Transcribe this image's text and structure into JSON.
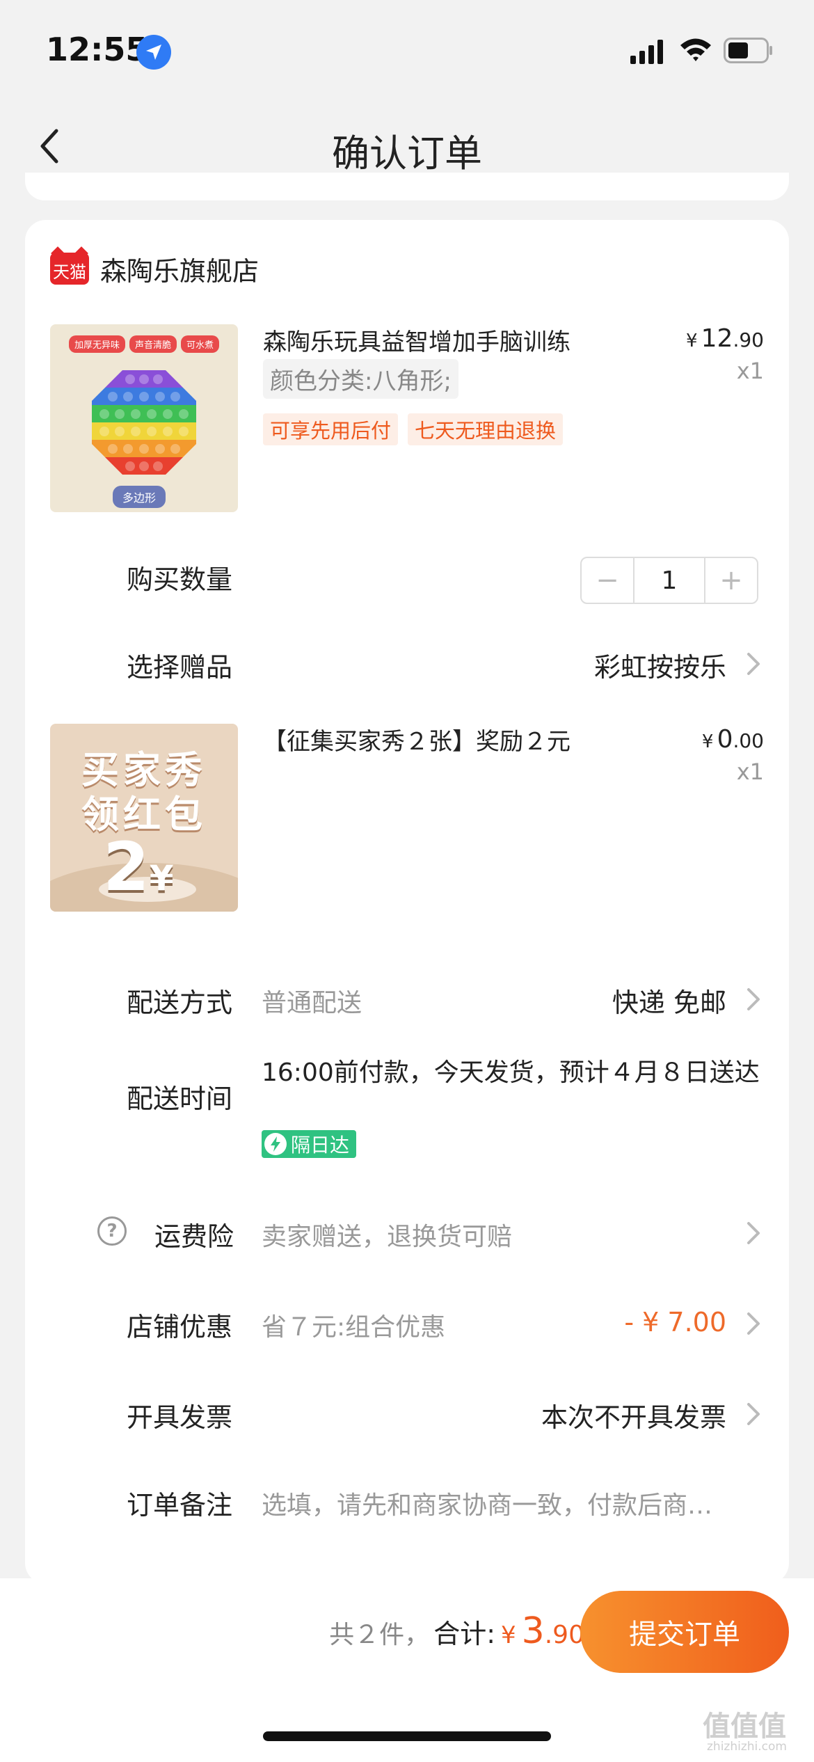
{
  "status_bar": {
    "time": "12:55"
  },
  "nav": {
    "title": "确认订单"
  },
  "shop": {
    "logo_text": "天猫",
    "name": "森陶乐旗舰店"
  },
  "product1": {
    "image_tags": [
      "加厚无异味",
      "声音清脆",
      "可水煮"
    ],
    "image_label": "多边形",
    "title": "森陶乐玩具益智增加手脑训练",
    "spec": "颜色分类:八角形;",
    "badges": [
      "可享先用后付",
      "七天无理由退换"
    ],
    "price_currency": "¥",
    "price_int": "12",
    "price_dec": ".90",
    "qty": "x1"
  },
  "quantity": {
    "label": "购买数量",
    "minus": "−",
    "value": "1",
    "plus": "+"
  },
  "gift": {
    "label": "选择赠品",
    "value": "彩虹按按乐"
  },
  "product2": {
    "image_line1": "买家秀",
    "image_line2": "领红包",
    "image_amount": "2",
    "image_currency": "¥",
    "title": "【征集买家秀２张】奖励２元",
    "price_currency": "¥",
    "price_int": "0",
    "price_dec": ".00",
    "qty": "x1"
  },
  "shipping": {
    "label": "配送方式",
    "desc": "普通配送",
    "value": "快递 免邮"
  },
  "delivery_time": {
    "label": "配送时间",
    "text": "16:00前付款，今天发货，预计４月８日送达",
    "badge": "隔日达"
  },
  "insurance": {
    "label": "运费险",
    "help": "?",
    "desc": "卖家赠送，退换货可赔"
  },
  "discount": {
    "label": "店铺优惠",
    "desc": "省７元:组合优惠",
    "value": "- ¥ 7.00"
  },
  "invoice": {
    "label": "开具发票",
    "value": "本次不开具发票"
  },
  "remark": {
    "label": "订单备注",
    "placeholder": "选填，请先和商家协商一致，付款后商…"
  },
  "summary": {
    "count": "共２件，",
    "total_label": "合计:",
    "currency": "¥",
    "int": "3",
    "dec": ".90",
    "submit": "提交订单"
  },
  "watermark": {
    "main": "值值值",
    "sub": "zhizhizhi.com"
  },
  "colors": {
    "accent": "#ee5a1e",
    "green": "#2fc281",
    "tmall": "#e5262a"
  }
}
